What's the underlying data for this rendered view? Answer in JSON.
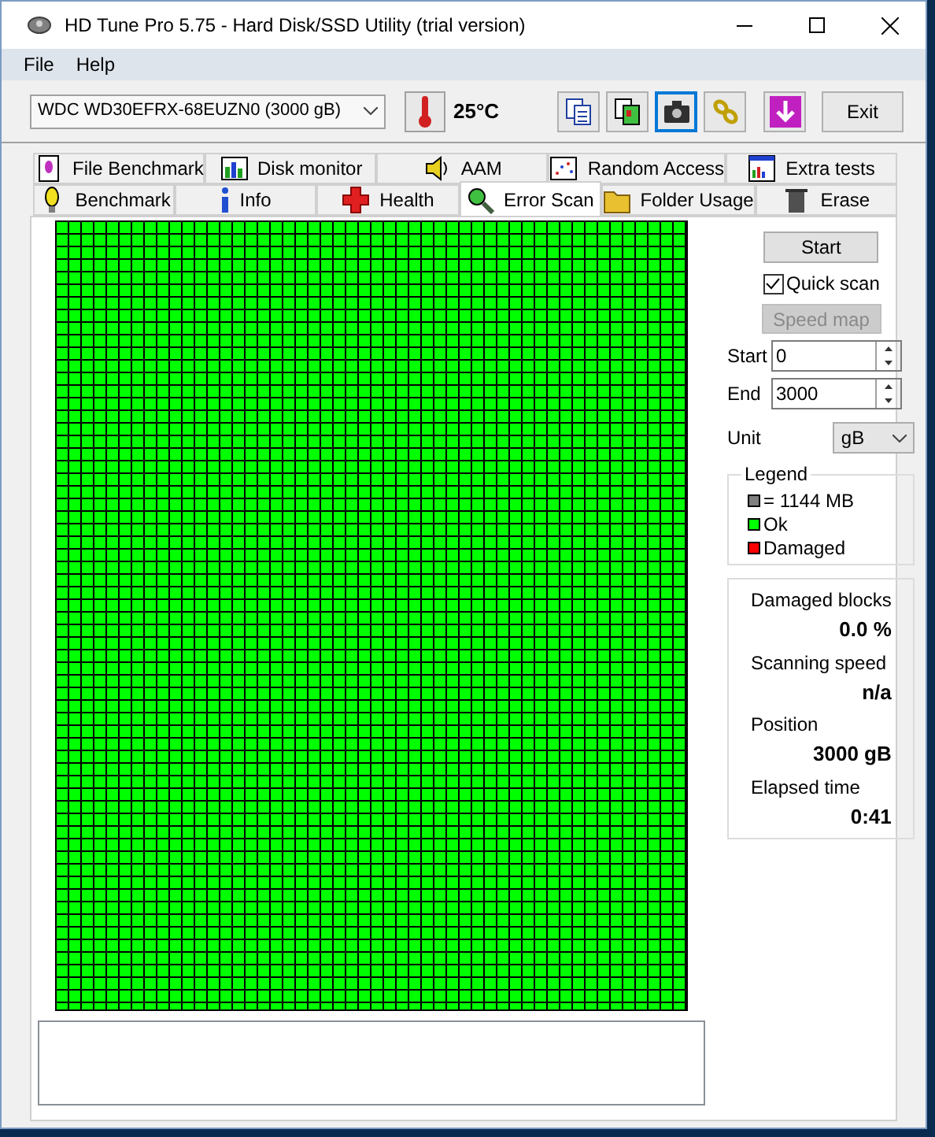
{
  "window": {
    "title": "HD Tune Pro 5.75 - Hard Disk/SSD Utility (trial version)"
  },
  "menu": [
    "File",
    "Help"
  ],
  "toolbar": {
    "drive": "WDC WD30EFRX-68EUZN0 (3000 gB)",
    "temperature": "25°C",
    "buttons": [
      {
        "kind": "copy",
        "selected": false
      },
      {
        "kind": "copy-all",
        "selected": false
      },
      {
        "kind": "camera",
        "selected": true
      },
      {
        "kind": "chain",
        "selected": false
      },
      {
        "kind": "download",
        "selected": false
      }
    ],
    "exit": "Exit"
  },
  "tabs": [
    [
      {
        "label": "File Benchmark",
        "kind": "file",
        "selected": false
      },
      {
        "label": "Disk monitor",
        "kind": "monitor",
        "selected": false
      },
      {
        "label": "AAM",
        "kind": "speaker",
        "selected": false
      },
      {
        "label": "Random Access",
        "kind": "scatter",
        "selected": false
      },
      {
        "label": "Extra tests",
        "kind": "extra",
        "selected": false
      }
    ],
    [
      {
        "label": "Benchmark",
        "kind": "bulb",
        "selected": false
      },
      {
        "label": "Info",
        "kind": "info",
        "selected": false
      },
      {
        "label": "Health",
        "kind": "cross",
        "selected": false
      },
      {
        "label": "Error Scan",
        "kind": "magnifier",
        "selected": true
      },
      {
        "label": "Folder Usage",
        "kind": "folder",
        "selected": false
      },
      {
        "label": "Erase",
        "kind": "trash",
        "selected": false
      }
    ]
  ],
  "scan": {
    "start_button": "Start",
    "quick_scan": {
      "label": "Quick scan",
      "checked": true
    },
    "speed_map": {
      "label": "Speed map",
      "disabled": true
    },
    "start": {
      "label": "Start",
      "value": "0"
    },
    "end": {
      "label": "End",
      "value": "3000"
    },
    "unit": {
      "label": "Unit",
      "value": "gB"
    },
    "legend": {
      "title": "Legend",
      "items": [
        {
          "label": "= 1144 MB",
          "color": "#808080"
        },
        {
          "label": "Ok",
          "color": "#00ff00"
        },
        {
          "label": "Damaged",
          "color": "#ff0000"
        }
      ]
    },
    "stats": [
      {
        "label": "Damaged blocks",
        "value": "0.0 %"
      },
      {
        "label": "Scanning speed",
        "value": "n/a"
      },
      {
        "label": "Position",
        "value": "3000 gB"
      },
      {
        "label": "Elapsed time",
        "value": "0:41"
      }
    ]
  }
}
